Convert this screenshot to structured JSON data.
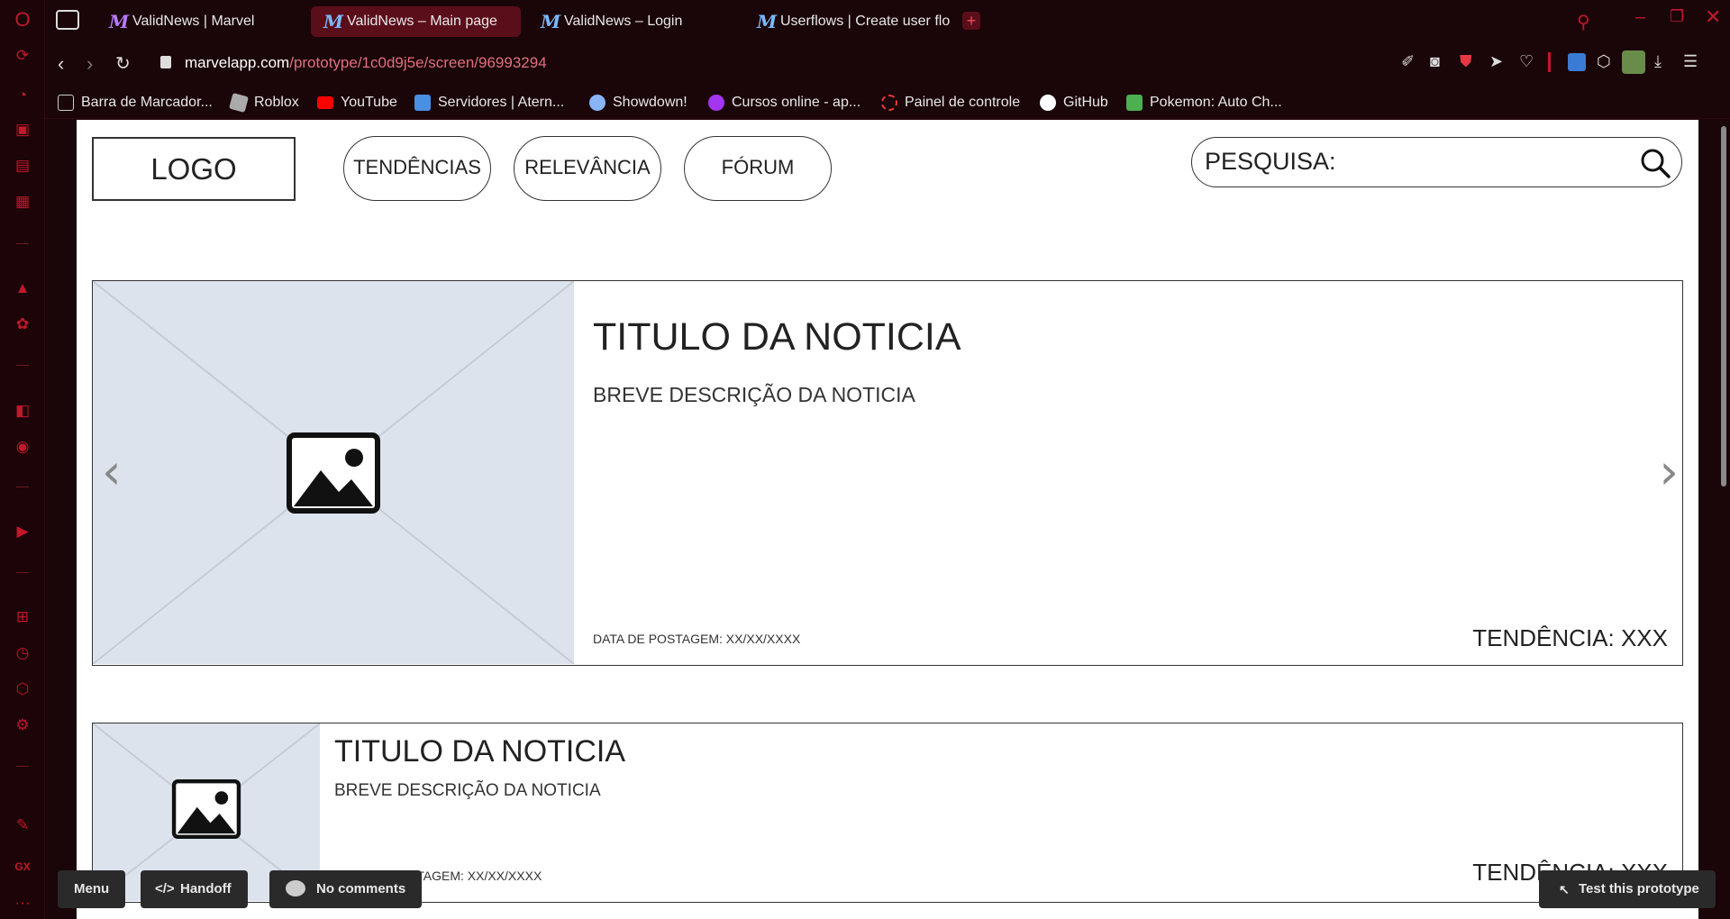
{
  "tabs": [
    {
      "label": "ValidNews | Marvel",
      "active": false
    },
    {
      "label": "ValidNews – Main page",
      "active": true
    },
    {
      "label": "ValidNews – Login",
      "active": false
    },
    {
      "label": "Userflows | Create user flo",
      "active": false
    }
  ],
  "address": {
    "domain": "marvelapp.com",
    "path": "/prototype/1c0d9j5e/screen/96993294"
  },
  "bookmarks": [
    {
      "label": "Barra de Marcador...",
      "icon": "folder-icon",
      "color": "#cccccc"
    },
    {
      "label": "Roblox",
      "icon": "roblox-icon",
      "color": "#aaaaaa"
    },
    {
      "label": "YouTube",
      "icon": "youtube-icon",
      "color": "#ff0000"
    },
    {
      "label": "Servidores | Atern...",
      "icon": "aternos-icon",
      "color": "#4a90e2"
    },
    {
      "label": "Showdown!",
      "icon": "pokeball-icon",
      "color": "#8ab4f8"
    },
    {
      "label": "Cursos online - ap...",
      "icon": "udemy-icon",
      "color": "#a435f0"
    },
    {
      "label": "Painel de controle",
      "icon": "panel-icon",
      "color": "#e53935"
    },
    {
      "label": "GitHub",
      "icon": "github-icon",
      "color": "#ffffff"
    },
    {
      "label": "Pokemon: Auto Ch...",
      "icon": "pokemon-icon",
      "color": "#4caf50"
    }
  ],
  "header": {
    "logo": "LOGO",
    "nav": [
      "TENDÊNCIAS",
      "RELEVÂNCIA",
      "FÓRUM"
    ],
    "search_label": "PESQUISA:"
  },
  "featured": {
    "title": "TITULO DA NOTICIA",
    "description": "BREVE DESCRIÇÃO DA NOTICIA",
    "date": "DATA DE POSTAGEM: XX/XX/XXXX",
    "trend": "TENDÊNCIA: XXX"
  },
  "secondary": {
    "title": "TITULO DA NOTICIA",
    "description": "BREVE DESCRIÇÃO DA NOTICIA",
    "date": "DATA DE POSTAGEM: XX/XX/XXXX",
    "trend": "TENDÊNCIA: XXX"
  },
  "bottom_bar": {
    "menu": "Menu",
    "handoff": "Handoff",
    "comments": "No comments",
    "test": "Test this prototype"
  },
  "colors": {
    "accent": "#c2182b",
    "chrome_bg": "#1a0508",
    "placeholder_bg": "#dde3ec"
  }
}
